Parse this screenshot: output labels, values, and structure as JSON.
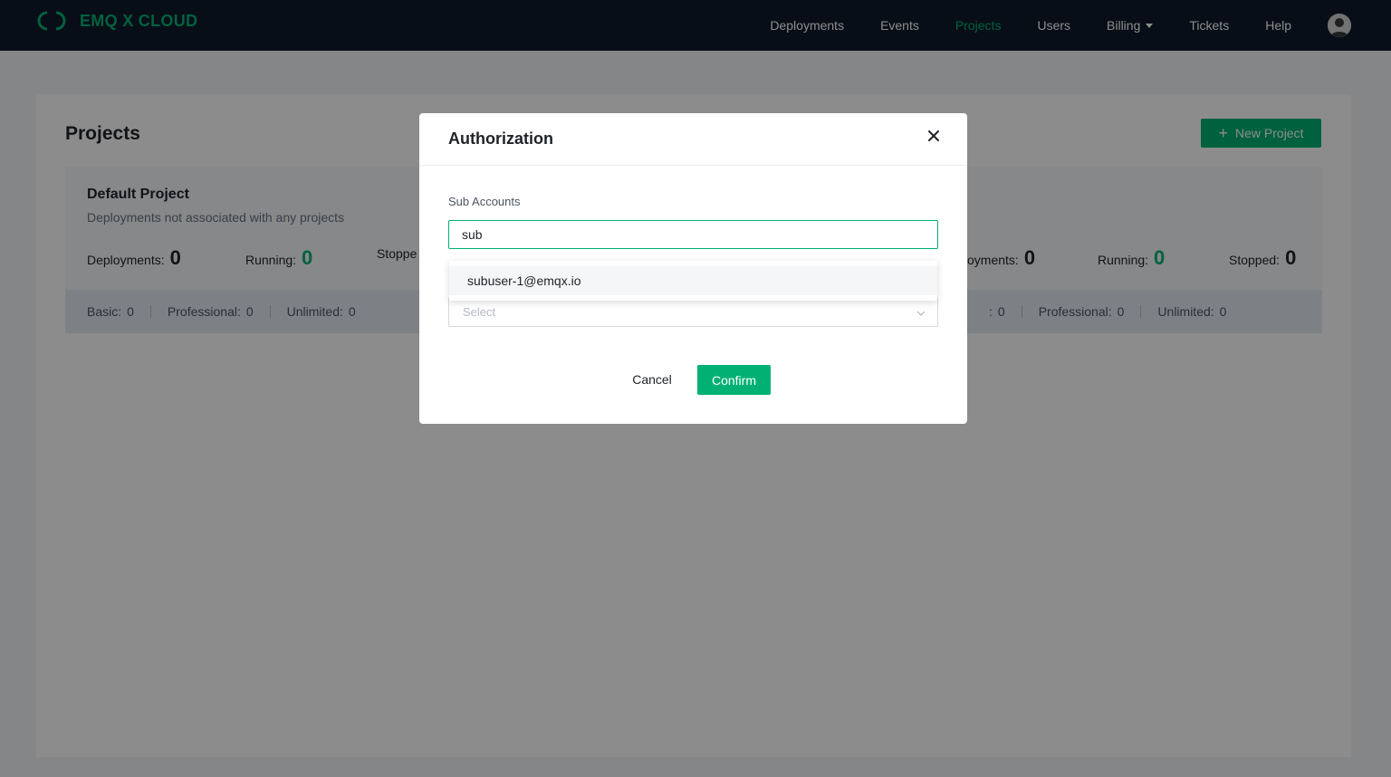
{
  "header": {
    "brand": "EMQ X CLOUD",
    "nav": [
      {
        "label": "Deployments",
        "active": false
      },
      {
        "label": "Events",
        "active": false
      },
      {
        "label": "Projects",
        "active": true
      },
      {
        "label": "Users",
        "active": false
      },
      {
        "label": "Billing",
        "active": false,
        "has_dropdown": true
      },
      {
        "label": "Tickets",
        "active": false
      },
      {
        "label": "Help",
        "active": false
      }
    ],
    "avatar_icon": "user-avatar-icon"
  },
  "page": {
    "title": "Projects",
    "new_project_label": "New Project",
    "plus_icon": "plus-icon"
  },
  "cards": [
    {
      "name": "Default Project",
      "description": "Deployments not associated with any projects",
      "deployments_label": "Deployments:",
      "deployments": "0",
      "running_label": "Running:",
      "running": "0",
      "stopped_label": "Stoppe",
      "basic_label": "Basic:",
      "basic": "0",
      "professional_label": "Professional:",
      "professional": "0",
      "unlimited_label": "Unlimited:",
      "unlimited": "0"
    },
    {
      "deployments_label": "oyments:",
      "deployments": "0",
      "running_label": "Running:",
      "running": "0",
      "stopped_label": "Stopped:",
      "stopped": "0",
      "basic_label": ":",
      "basic": "0",
      "professional_label": "Professional:",
      "professional": "0",
      "unlimited_label": "Unlimited:",
      "unlimited": "0"
    }
  ],
  "modal": {
    "title": "Authorization",
    "close_icon": "close-icon",
    "field_label": "Sub Accounts",
    "input_value": "sub",
    "dropdown_option": "subuser-1@emqx.io",
    "select_placeholder": "Select",
    "cancel_label": "Cancel",
    "confirm_label": "Confirm"
  },
  "colors": {
    "brand": "#00b173",
    "header_bg": "#0f1a2a",
    "overlay": "rgba(0,0,0,0.45)"
  }
}
